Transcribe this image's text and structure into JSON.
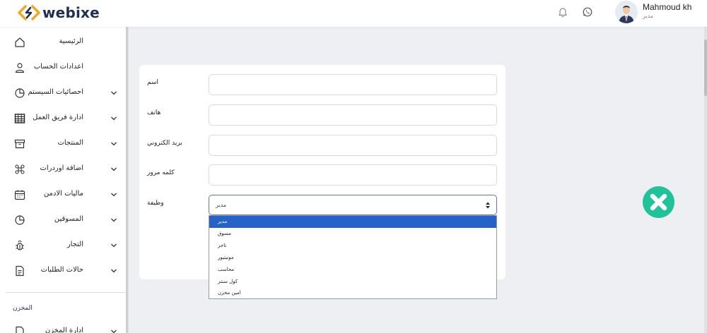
{
  "brand": {
    "name": "webixe"
  },
  "header": {
    "notification_icon": "bell-icon",
    "whatsapp_icon": "whatsapp-icon",
    "user": {
      "name": "Mahmoud kh",
      "role": "مدير"
    }
  },
  "sidebar": {
    "items": [
      {
        "label": "الرئيسية",
        "icon": "home-icon",
        "has_chevron": false
      },
      {
        "label": "اعدادات الحساب",
        "icon": "user-icon",
        "has_chevron": false
      },
      {
        "label": "احصائيات السيستم",
        "icon": "pie-chart-icon",
        "has_chevron": true
      },
      {
        "label": "ادارة فريق العمل",
        "icon": "table-icon",
        "has_chevron": true
      },
      {
        "label": "المنتجات",
        "icon": "archive-icon",
        "has_chevron": true
      },
      {
        "label": "اضافة اوردرات",
        "icon": "command-icon",
        "has_chevron": true
      },
      {
        "label": "ماليات الادمن",
        "icon": "calendar-icon",
        "has_chevron": true
      },
      {
        "label": "المسوقين",
        "icon": "pie-chart-icon",
        "has_chevron": true
      },
      {
        "label": "التجار",
        "icon": "bug-icon",
        "has_chevron": true
      },
      {
        "label": "حالات الطلبات",
        "icon": "document-icon",
        "has_chevron": true
      },
      {
        "label": "ادارة المخزن",
        "icon": "document-icon",
        "has_chevron": true
      }
    ],
    "section_label": "المخزن"
  },
  "form": {
    "fields": [
      {
        "label": "اسم",
        "value": ""
      },
      {
        "label": "هاتف",
        "value": ""
      },
      {
        "label": "بريد الكتروني",
        "value": ""
      },
      {
        "label": "كلمه مرور",
        "value": ""
      }
    ],
    "job": {
      "label": "وظيفة",
      "selected": "مدير",
      "options": [
        "مدير",
        "مسوق",
        "تاجر",
        "مونيتيور",
        "محاسب",
        "كول سنتر",
        "امين مخزن"
      ],
      "highlighted_index": 0
    }
  },
  "fab": {
    "icon": "close-icon",
    "color": "#20c29a"
  },
  "colors": {
    "brand_navy": "#1f2f52",
    "brand_orange": "#f5a623",
    "accent": "#2563c9"
  }
}
